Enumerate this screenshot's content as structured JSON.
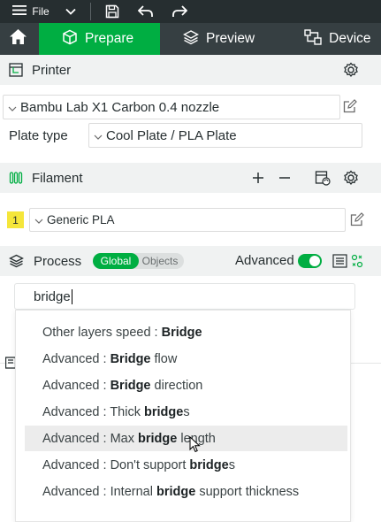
{
  "titlebar": {
    "file_menu_label": "File",
    "icons": [
      "hamburger-icon",
      "chevron-down-icon",
      "save-icon",
      "undo-icon",
      "redo-icon"
    ]
  },
  "tabs": {
    "prepare": "Prepare",
    "preview": "Preview",
    "device": "Device",
    "active": "Prepare",
    "accent_color": "#00ae42"
  },
  "printer": {
    "section_title": "Printer",
    "selected_printer": "Bambu Lab X1 Carbon 0.4 nozzle",
    "plate_type_label": "Plate type",
    "plate_type_value": "Cool Plate / PLA Plate"
  },
  "filament": {
    "section_title": "Filament",
    "items": [
      {
        "index": "1",
        "name": "Generic PLA",
        "color": "#f5e63a"
      }
    ]
  },
  "process": {
    "section_title": "Process",
    "scope_global": "Global",
    "scope_objects": "Objects",
    "active_scope": "Global",
    "advanced_label": "Advanced",
    "advanced_enabled": true
  },
  "search": {
    "query": "bridge",
    "results": [
      {
        "pre": "Other layers speed : ",
        "match": "Bridge",
        "post": ""
      },
      {
        "pre": "Advanced : ",
        "match": "Bridge",
        "post": " flow"
      },
      {
        "pre": "Advanced : ",
        "match": "Bridge",
        "post": " direction"
      },
      {
        "pre": "Advanced : Thick ",
        "match": "bridge",
        "post": "s"
      },
      {
        "pre": "Advanced : Max ",
        "match": "bridge",
        "post": " length"
      },
      {
        "pre": "Advanced : Don't support ",
        "match": "bridge",
        "post": "s"
      },
      {
        "pre": "Advanced : Internal ",
        "match": "bridge",
        "post": " support thickness"
      }
    ],
    "hovered_result": "Advanced : Max bridge length"
  }
}
